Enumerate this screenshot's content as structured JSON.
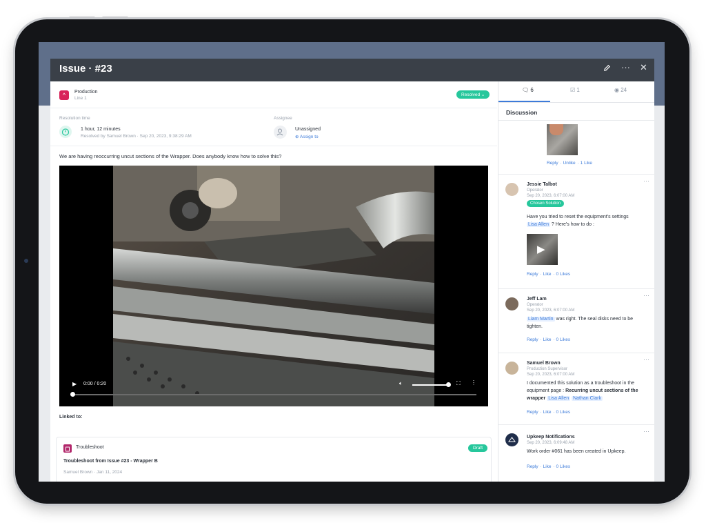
{
  "header": {
    "title": "Issue · #23",
    "edit_icon": "pencil-icon",
    "more_icon": "more-icon",
    "close_icon": "close-icon"
  },
  "asset": {
    "name": "Production",
    "sub": "Line 1",
    "icon": "chevron-up-icon",
    "status": "Resolved",
    "status_color": "#26c79c"
  },
  "resolution": {
    "label": "Resolution time",
    "value": "1 hour, 12 minutes",
    "resolved_by": "Resolved by Samuel Brown · Sep 20, 2023, 9:38:29 AM"
  },
  "assignee": {
    "label": "Assignee",
    "value": "Unassigned",
    "action": "Assign to"
  },
  "description": "We are having reoccurring uncut sections of the Wrapper. Does anybody know how to solve this?",
  "video": {
    "time": "0:00 / 0:20",
    "progress": 0
  },
  "linked": {
    "label": "Linked to:",
    "card_type": "Troubleshoot",
    "card_status": "Draft",
    "card_title": "Troubleshoot from Issue #23 - Wrapper B",
    "card_meta": "Samuel Brown · Jan 11, 2024"
  },
  "tabs": [
    {
      "label": "6",
      "icon": "comment-icon"
    },
    {
      "label": "1",
      "icon": "checklist-icon"
    },
    {
      "label": "24",
      "icon": "eye-icon"
    }
  ],
  "discussion_title": "Discussion",
  "top_actions": {
    "reply": "Reply",
    "unlike": "Unlike",
    "likes": "1 Like"
  },
  "comments": [
    {
      "name": "Jessie Talbot",
      "role": "Operator",
      "date": "Sep 20, 2023, 6:07:00 AM",
      "chip": "Chosen Solution",
      "text_a": "Have you tried to reset the equipment's settings",
      "mention": "Lisa Allen",
      "text_b": "? Here's how to do :",
      "reply": "Reply",
      "like": "Like",
      "likes": "0 Likes"
    },
    {
      "name": "Jeff Lam",
      "role": "Operator",
      "date": "Sep 20, 2023, 6:07:00 AM",
      "mention": "Liam Martin",
      "text": "was right. The seal disks need to be tighten.",
      "reply": "Reply",
      "like": "Like",
      "likes": "0 Likes"
    },
    {
      "name": "Samuel Brown",
      "role": "Production Supervisor",
      "date": "Sep 20, 2023, 6:07:00 AM",
      "text_a": "I documented this solution as a troubleshoot in the equipment page :",
      "bold": "Recurring uncut sections of the wrapper",
      "mention_1": "Lisa Allen",
      "mention_2": "Nathan Clark",
      "reply": "Reply",
      "like": "Like",
      "likes": "0 Likes"
    },
    {
      "name": "Upkeep Notifications",
      "date": "Sep 20, 2023, 6:09:48 AM",
      "text": "Work order #061 has been created in Upkeep.",
      "reply": "Reply",
      "like": "Like",
      "likes": "0 Likes"
    }
  ]
}
